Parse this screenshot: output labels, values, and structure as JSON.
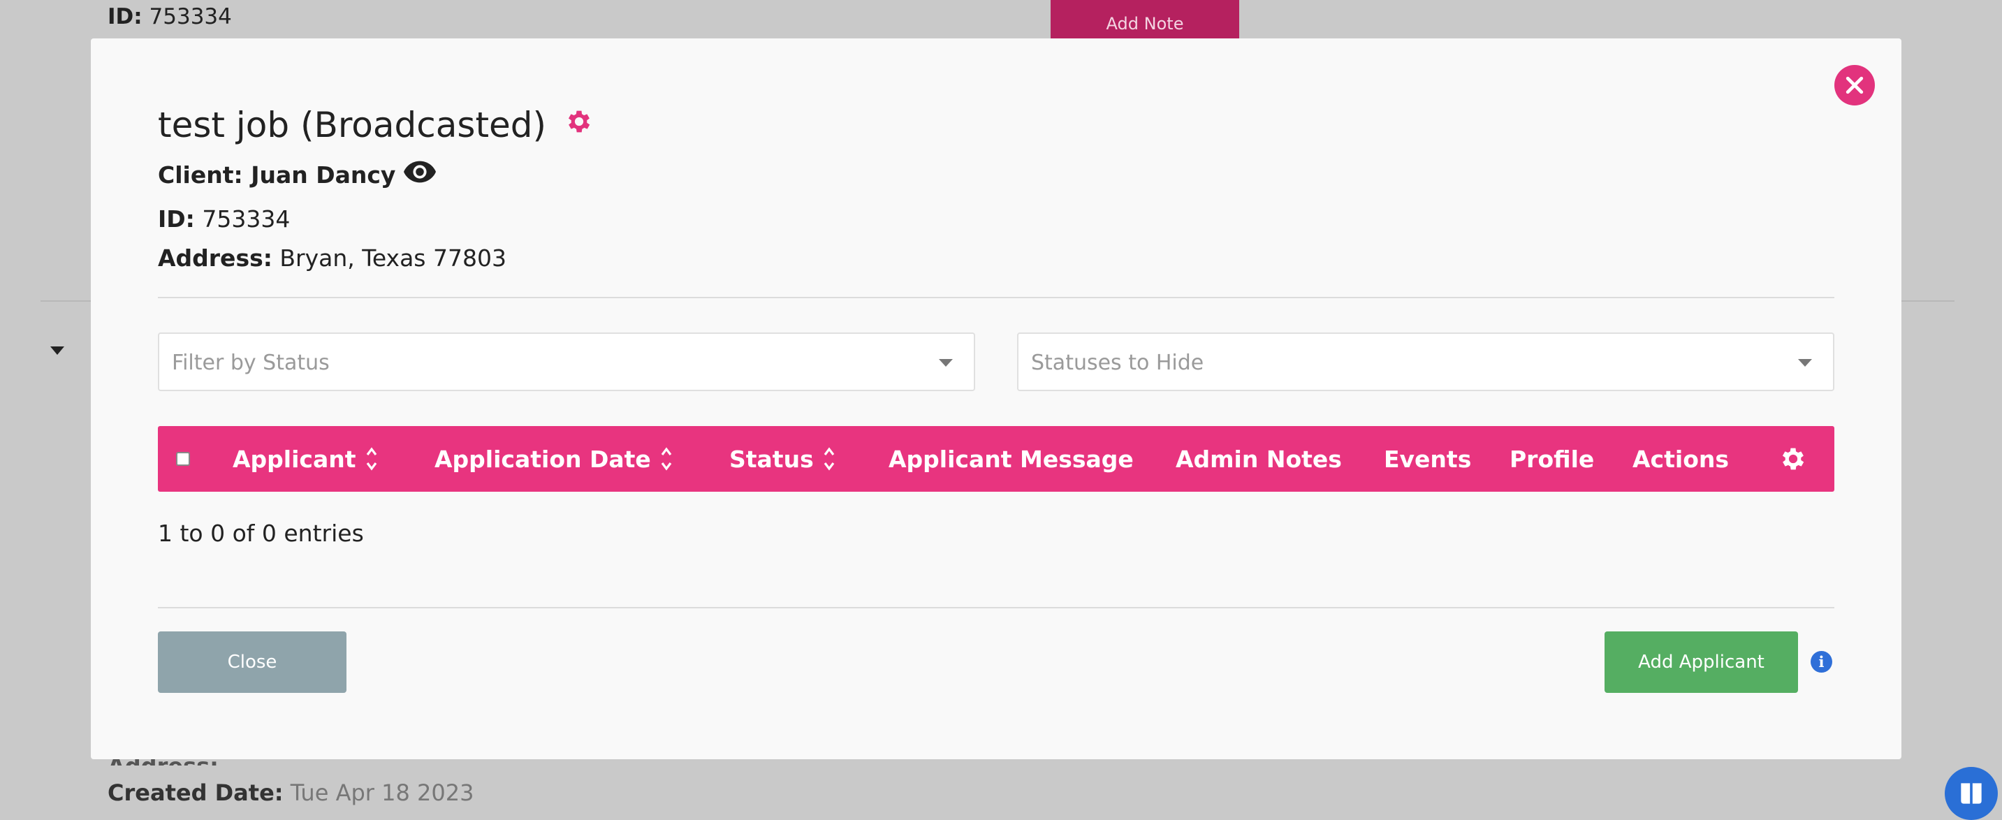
{
  "background": {
    "id_label": "ID:",
    "id_value": "753334",
    "add_note_label": "Add Note",
    "address_label": "Address:",
    "created_label": "Created Date:",
    "created_value": "Tue Apr 18 2023"
  },
  "modal": {
    "title": "test job (Broadcasted)",
    "client_label": "Client:",
    "client_name": "Juan Dancy",
    "id_label": "ID:",
    "id_value": "753334",
    "address_label": "Address:",
    "address_value": "Bryan, Texas 77803",
    "filters": {
      "status_placeholder": "Filter by Status",
      "hide_placeholder": "Statuses to Hide"
    },
    "table": {
      "columns": [
        "Applicant",
        "Application Date",
        "Status",
        "Applicant Message",
        "Admin Notes",
        "Events",
        "Profile",
        "Actions"
      ],
      "entries_text": "1 to 0 of 0 entries"
    },
    "buttons": {
      "close": "Close",
      "add_applicant": "Add Applicant"
    },
    "info_icon": "i"
  },
  "colors": {
    "accent": "#e8347f",
    "close_circle": "#e2337d",
    "add_button": "#55ae62",
    "close_button": "#8fa4ab",
    "info": "#2f6fd8"
  },
  "icons": {
    "settings": "gear-icon",
    "view": "eye-icon",
    "close": "close-icon",
    "sort": "sort-icon",
    "info": "info-icon",
    "help": "book-icon"
  }
}
